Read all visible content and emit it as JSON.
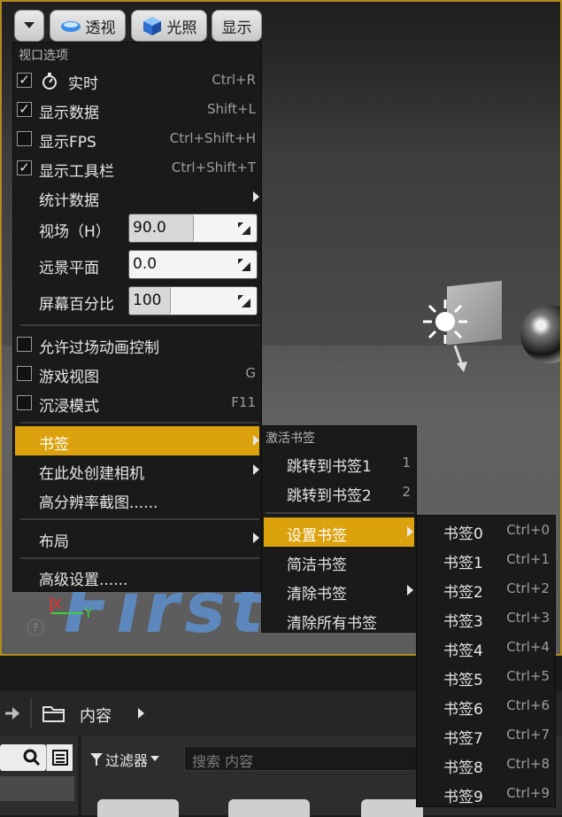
{
  "toolbar": {
    "perspective_label": "透视",
    "lighting_label": "光照",
    "show_label": "显示"
  },
  "viewport_menu": {
    "section_title": "视口选项",
    "realtime": {
      "label": "实时",
      "shortcut": "Ctrl+R",
      "checked": true
    },
    "show_stats": {
      "label": "显示数据",
      "shortcut": "Shift+L",
      "checked": true
    },
    "show_fps": {
      "label": "显示FPS",
      "shortcut": "Ctrl+Shift+H",
      "checked": false
    },
    "show_toolbar": {
      "label": "显示工具栏",
      "shortcut": "Ctrl+Shift+T",
      "checked": true
    },
    "stat_data": {
      "label": "统计数据"
    },
    "fov": {
      "label": "视场（H）",
      "value": "90.0",
      "fill_fraction": 0.5
    },
    "far_plane": {
      "label": "远景平面",
      "value": "0.0",
      "fill_fraction": 0.0
    },
    "screen_pct": {
      "label": "屏幕百分比",
      "value": "100",
      "fill_fraction": 0.33
    },
    "cinematic_control": {
      "label": "允许过场动画控制",
      "checked": false
    },
    "game_view": {
      "label": "游戏视图",
      "shortcut": "G",
      "checked": false
    },
    "immersive": {
      "label": "沉浸模式",
      "shortcut": "F11",
      "checked": false
    },
    "bookmarks": {
      "label": "书签"
    },
    "create_camera": {
      "label": "在此处创建相机"
    },
    "high_res_shot": {
      "label": "高分辨率截图......"
    },
    "layout": {
      "label": "布局"
    },
    "advanced": {
      "label": "高级设置......"
    }
  },
  "bookmark_menu": {
    "section_title": "激活书签",
    "jump1": {
      "label": "跳转到书签1",
      "shortcut": "1"
    },
    "jump2": {
      "label": "跳转到书签2",
      "shortcut": "2"
    },
    "set_bookmark": {
      "label": "设置书签"
    },
    "compact": {
      "label": "简洁书签"
    },
    "clear": {
      "label": "清除书签"
    },
    "clear_all": {
      "label": "清除所有书签"
    }
  },
  "set_bookmark_menu": {
    "items": [
      {
        "label": "书签0",
        "shortcut": "Ctrl+0"
      },
      {
        "label": "书签1",
        "shortcut": "Ctrl+1"
      },
      {
        "label": "书签2",
        "shortcut": "Ctrl+2"
      },
      {
        "label": "书签3",
        "shortcut": "Ctrl+3"
      },
      {
        "label": "书签4",
        "shortcut": "Ctrl+4"
      },
      {
        "label": "书签5",
        "shortcut": "Ctrl+5"
      },
      {
        "label": "书签6",
        "shortcut": "Ctrl+6"
      },
      {
        "label": "书签7",
        "shortcut": "Ctrl+7"
      },
      {
        "label": "书签8",
        "shortcut": "Ctrl+8"
      },
      {
        "label": "书签9",
        "shortcut": "Ctrl+9"
      }
    ]
  },
  "viewport": {
    "logo_text": "First",
    "axis_x": "X",
    "axis_y": "Y",
    "help": "?"
  },
  "content_browser": {
    "breadcrumb": "内容",
    "filter_label": "过滤器",
    "search_placeholder": "搜索 内容"
  },
  "colors": {
    "highlight": "#dca20e",
    "menu_bg": "#1a1a1a",
    "viewport_border": "#b38a1c"
  }
}
